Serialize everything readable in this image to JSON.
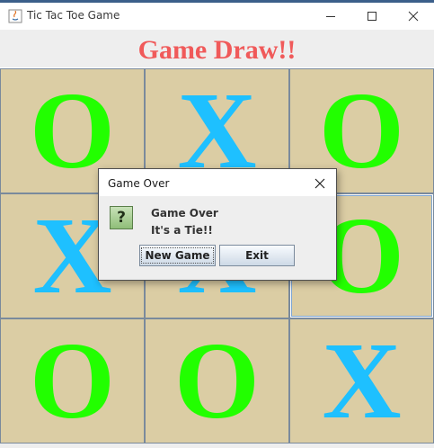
{
  "window": {
    "title": "Tic Tac Toe Game"
  },
  "status": {
    "text": "Game Draw!!",
    "color": "#f05a5a"
  },
  "colors": {
    "o_mark": "#22ff00",
    "x_mark": "#1ec0ff",
    "cell_bg": "#dbcda4"
  },
  "board": {
    "cells": [
      {
        "mark": "O"
      },
      {
        "mark": "X"
      },
      {
        "mark": "O"
      },
      {
        "mark": "X"
      },
      {
        "mark": "X"
      },
      {
        "mark": "O"
      },
      {
        "mark": "O"
      },
      {
        "mark": "O"
      },
      {
        "mark": "X"
      }
    ]
  },
  "dialog": {
    "title": "Game Over",
    "icon": "question-icon",
    "icon_glyph": "?",
    "message_line1": "Game Over",
    "message_line2": "It's a Tie!!",
    "buttons": {
      "new_game": "New Game",
      "exit": "Exit"
    }
  }
}
